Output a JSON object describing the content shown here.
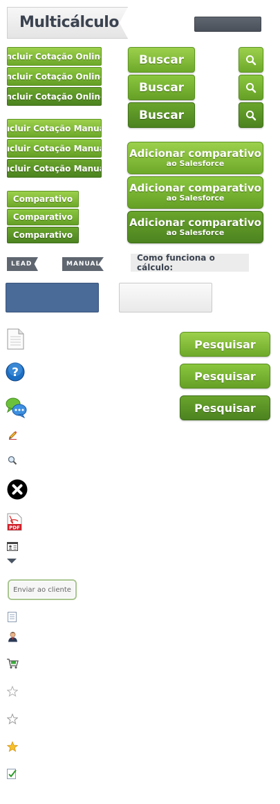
{
  "title": "Multicálculo",
  "buttons": {
    "incluir_online": "Incluir Cotação Online",
    "incluir_manual": "Incluir Cotação Manual",
    "comparativo": "Comparativo",
    "buscar": "Buscar",
    "adicionar_line1": "Adicionar comparativo",
    "adicionar_line2": "ao Salesforce",
    "pesquisar": "Pesquisar",
    "enviar": "Enviar ao cliente"
  },
  "tags": {
    "lead": "LEAD",
    "manual": "MANUAL"
  },
  "como_funciona": "Como funciona o cálculo:",
  "icons": [
    "document-icon",
    "help-icon",
    "chat-bubbles-icon",
    "pencil-icon",
    "magnifier-icon",
    "close-icon",
    "pdf-icon",
    "contact-card-icon",
    "caret-down-icon",
    "small-document-icon",
    "user-icon",
    "cart-icon",
    "star-empty-icon",
    "star-empty-icon",
    "star-filled-icon",
    "checklist-icon"
  ],
  "pdf_label": "PDF",
  "colors": {
    "green_light": "#9cd04c",
    "green_mid": "#8bc63f",
    "green_dark": "#4c8320",
    "slate": "#5f6670",
    "blue": "#4a6a97",
    "title_text": "#3b4350"
  }
}
